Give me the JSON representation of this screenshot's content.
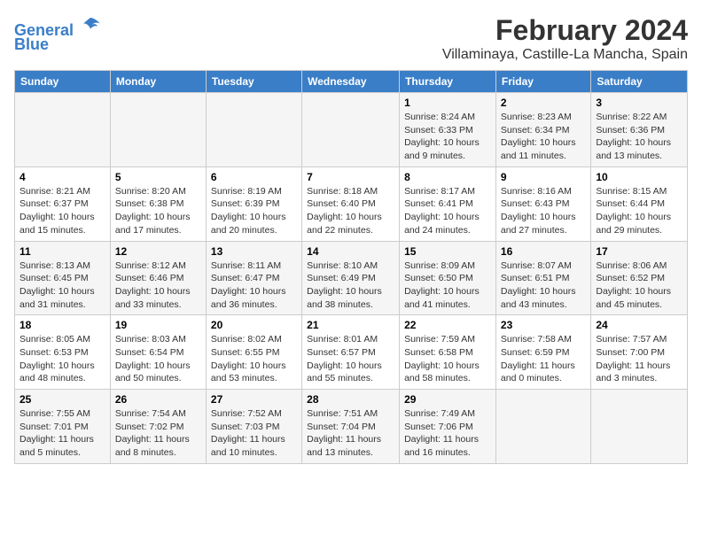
{
  "logo": {
    "line1": "General",
    "line2": "Blue"
  },
  "title": "February 2024",
  "subtitle": "Villaminaya, Castille-La Mancha, Spain",
  "days_of_week": [
    "Sunday",
    "Monday",
    "Tuesday",
    "Wednesday",
    "Thursday",
    "Friday",
    "Saturday"
  ],
  "weeks": [
    [
      {
        "day": "",
        "info": ""
      },
      {
        "day": "",
        "info": ""
      },
      {
        "day": "",
        "info": ""
      },
      {
        "day": "",
        "info": ""
      },
      {
        "day": "1",
        "info": "Sunrise: 8:24 AM\nSunset: 6:33 PM\nDaylight: 10 hours\nand 9 minutes."
      },
      {
        "day": "2",
        "info": "Sunrise: 8:23 AM\nSunset: 6:34 PM\nDaylight: 10 hours\nand 11 minutes."
      },
      {
        "day": "3",
        "info": "Sunrise: 8:22 AM\nSunset: 6:36 PM\nDaylight: 10 hours\nand 13 minutes."
      }
    ],
    [
      {
        "day": "4",
        "info": "Sunrise: 8:21 AM\nSunset: 6:37 PM\nDaylight: 10 hours\nand 15 minutes."
      },
      {
        "day": "5",
        "info": "Sunrise: 8:20 AM\nSunset: 6:38 PM\nDaylight: 10 hours\nand 17 minutes."
      },
      {
        "day": "6",
        "info": "Sunrise: 8:19 AM\nSunset: 6:39 PM\nDaylight: 10 hours\nand 20 minutes."
      },
      {
        "day": "7",
        "info": "Sunrise: 8:18 AM\nSunset: 6:40 PM\nDaylight: 10 hours\nand 22 minutes."
      },
      {
        "day": "8",
        "info": "Sunrise: 8:17 AM\nSunset: 6:41 PM\nDaylight: 10 hours\nand 24 minutes."
      },
      {
        "day": "9",
        "info": "Sunrise: 8:16 AM\nSunset: 6:43 PM\nDaylight: 10 hours\nand 27 minutes."
      },
      {
        "day": "10",
        "info": "Sunrise: 8:15 AM\nSunset: 6:44 PM\nDaylight: 10 hours\nand 29 minutes."
      }
    ],
    [
      {
        "day": "11",
        "info": "Sunrise: 8:13 AM\nSunset: 6:45 PM\nDaylight: 10 hours\nand 31 minutes."
      },
      {
        "day": "12",
        "info": "Sunrise: 8:12 AM\nSunset: 6:46 PM\nDaylight: 10 hours\nand 33 minutes."
      },
      {
        "day": "13",
        "info": "Sunrise: 8:11 AM\nSunset: 6:47 PM\nDaylight: 10 hours\nand 36 minutes."
      },
      {
        "day": "14",
        "info": "Sunrise: 8:10 AM\nSunset: 6:49 PM\nDaylight: 10 hours\nand 38 minutes."
      },
      {
        "day": "15",
        "info": "Sunrise: 8:09 AM\nSunset: 6:50 PM\nDaylight: 10 hours\nand 41 minutes."
      },
      {
        "day": "16",
        "info": "Sunrise: 8:07 AM\nSunset: 6:51 PM\nDaylight: 10 hours\nand 43 minutes."
      },
      {
        "day": "17",
        "info": "Sunrise: 8:06 AM\nSunset: 6:52 PM\nDaylight: 10 hours\nand 45 minutes."
      }
    ],
    [
      {
        "day": "18",
        "info": "Sunrise: 8:05 AM\nSunset: 6:53 PM\nDaylight: 10 hours\nand 48 minutes."
      },
      {
        "day": "19",
        "info": "Sunrise: 8:03 AM\nSunset: 6:54 PM\nDaylight: 10 hours\nand 50 minutes."
      },
      {
        "day": "20",
        "info": "Sunrise: 8:02 AM\nSunset: 6:55 PM\nDaylight: 10 hours\nand 53 minutes."
      },
      {
        "day": "21",
        "info": "Sunrise: 8:01 AM\nSunset: 6:57 PM\nDaylight: 10 hours\nand 55 minutes."
      },
      {
        "day": "22",
        "info": "Sunrise: 7:59 AM\nSunset: 6:58 PM\nDaylight: 10 hours\nand 58 minutes."
      },
      {
        "day": "23",
        "info": "Sunrise: 7:58 AM\nSunset: 6:59 PM\nDaylight: 11 hours\nand 0 minutes."
      },
      {
        "day": "24",
        "info": "Sunrise: 7:57 AM\nSunset: 7:00 PM\nDaylight: 11 hours\nand 3 minutes."
      }
    ],
    [
      {
        "day": "25",
        "info": "Sunrise: 7:55 AM\nSunset: 7:01 PM\nDaylight: 11 hours\nand 5 minutes."
      },
      {
        "day": "26",
        "info": "Sunrise: 7:54 AM\nSunset: 7:02 PM\nDaylight: 11 hours\nand 8 minutes."
      },
      {
        "day": "27",
        "info": "Sunrise: 7:52 AM\nSunset: 7:03 PM\nDaylight: 11 hours\nand 10 minutes."
      },
      {
        "day": "28",
        "info": "Sunrise: 7:51 AM\nSunset: 7:04 PM\nDaylight: 11 hours\nand 13 minutes."
      },
      {
        "day": "29",
        "info": "Sunrise: 7:49 AM\nSunset: 7:06 PM\nDaylight: 11 hours\nand 16 minutes."
      },
      {
        "day": "",
        "info": ""
      },
      {
        "day": "",
        "info": ""
      }
    ]
  ]
}
